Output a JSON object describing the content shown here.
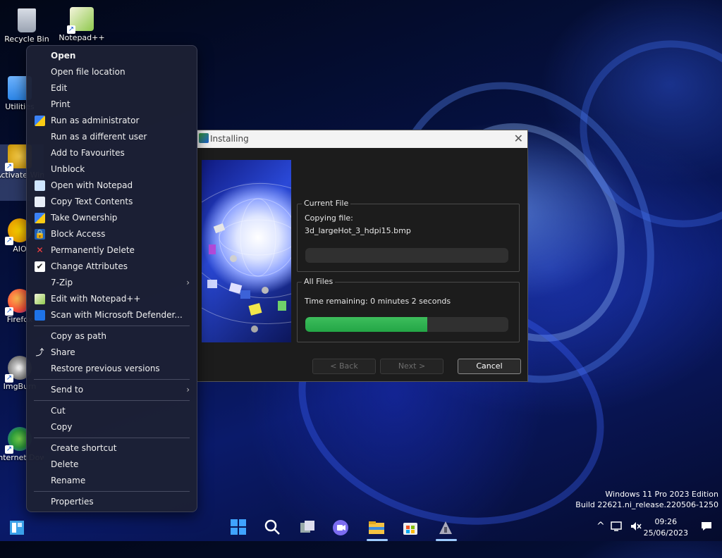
{
  "desktop_icons": [
    {
      "label": "Recycle Bin"
    },
    {
      "label": "Notepad++"
    },
    {
      "label": "Utilities"
    },
    {
      "label": "Activate Windows"
    },
    {
      "label": "AIO"
    },
    {
      "label": "Firefox"
    },
    {
      "label": "ImgBurn"
    },
    {
      "label": "Internet Download Manager"
    }
  ],
  "context_menu": {
    "groups": [
      [
        {
          "label": "Open",
          "bold": true,
          "icon": ""
        },
        {
          "label": "Open file location",
          "icon": ""
        },
        {
          "label": "Edit",
          "icon": ""
        },
        {
          "label": "Print",
          "icon": ""
        },
        {
          "label": "Run as administrator",
          "icon": "uac-shield-icon"
        },
        {
          "label": "Run as a different user",
          "icon": ""
        },
        {
          "label": "Add to Favourites",
          "icon": ""
        },
        {
          "label": "Unblock",
          "icon": ""
        },
        {
          "label": "Open with Notepad",
          "icon": "notepad-icon"
        },
        {
          "label": "Copy Text Contents",
          "icon": "copy-text-icon"
        },
        {
          "label": "Take Ownership",
          "icon": "uac-shield-icon"
        },
        {
          "label": "Block Access",
          "icon": "lock-icon"
        },
        {
          "label": "Permanently Delete",
          "icon": "red-x-icon"
        },
        {
          "label": "Change Attributes",
          "icon": "checkbox-icon"
        },
        {
          "label": "7-Zip",
          "icon": "",
          "submenu": true
        },
        {
          "label": "Edit with Notepad++",
          "icon": "notepadpp-icon"
        },
        {
          "label": "Scan with Microsoft Defender...",
          "icon": "defender-shield-icon"
        }
      ],
      [
        {
          "label": "Copy as path",
          "icon": ""
        },
        {
          "label": "Share",
          "icon": "share-icon"
        },
        {
          "label": "Restore previous versions",
          "icon": ""
        }
      ],
      [
        {
          "label": "Send to",
          "icon": "",
          "submenu": true
        }
      ],
      [
        {
          "label": "Cut",
          "icon": ""
        },
        {
          "label": "Copy",
          "icon": ""
        }
      ],
      [
        {
          "label": "Create shortcut",
          "icon": ""
        },
        {
          "label": "Delete",
          "icon": ""
        },
        {
          "label": "Rename",
          "icon": ""
        }
      ],
      [
        {
          "label": "Properties",
          "icon": ""
        }
      ]
    ]
  },
  "installer": {
    "title": "Installing",
    "current_file": {
      "legend": "Current File",
      "line1": "Copying file:",
      "line2": "3d_largeHot_3_hdpi15.bmp",
      "progress": 0
    },
    "all_files": {
      "legend": "All Files",
      "time_remaining": "Time remaining: 0 minutes 2 seconds",
      "progress": 0.6
    },
    "buttons": {
      "back": "< Back",
      "next": "Next >",
      "cancel": "Cancel"
    }
  },
  "watermark": {
    "line1": "Windows 11 Pro 2023 Edition",
    "line2": "Build 22621.ni_release.220506-1250"
  },
  "taskbar": {
    "clock_time": "09:26",
    "clock_date": "25/06/2023",
    "tray_chevron": "^"
  },
  "colors": {
    "accent_green": "#23a646",
    "menu_bg": "#1c2034",
    "desktop_blue": "#0a1a6a"
  }
}
